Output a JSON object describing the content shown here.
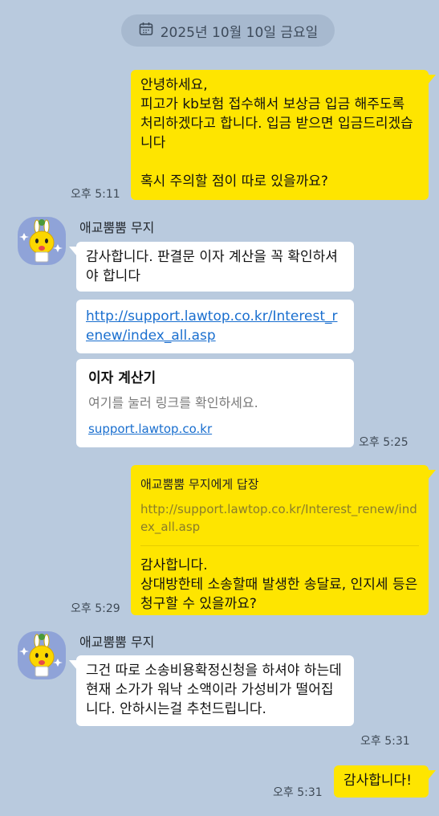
{
  "date_label": "2025년 10월 10일 금요일",
  "messages": {
    "m1": {
      "text": "안녕하세요,\n피고가 kb보험 접수해서 보상금 입금 해주도록 처리하겠다고 합니다. 입금 받으면 입금드리겠습니다\n\n혹시 주의할 점이 따로 있을까요?",
      "time": "오후 5:11"
    },
    "sender1": "애교뿜뿜 무지",
    "m2": {
      "text": "감사합니다. 판결문 이자 계산을 꼭 확인하셔야 합니다"
    },
    "m3": {
      "link": "http://support.lawtop.co.kr/Interest_renew/index_all.asp"
    },
    "m4": {
      "title": "이자 계산기",
      "desc": "여기를 눌러 링크를 확인하세요.",
      "domain": "support.lawtop.co.kr",
      "time": "오후 5:25"
    },
    "m5": {
      "reply_to": "애교뿜뿜 무지에게 답장",
      "quote": "http://support.lawtop.co.kr/Interest_renew/index_all.asp",
      "text": "감사합니다.\n상대방한테 소송할때 발생한 송달료, 인지세 등은 청구할 수 있을까요?",
      "time": "오후 5:29"
    },
    "sender2": "애교뿜뿜 무지",
    "m6": {
      "text": "그건 따로 소송비용확정신청을 하셔야 하는데\n현재 소가가 워낙 소액이라 가성비가 떨어집니다. 안하시는걸 추천드립니다.",
      "time": "오후 5:31"
    },
    "m7": {
      "text": "감사합니다!",
      "time": "오후 5:31"
    }
  },
  "colors": {
    "background": "#b9cade",
    "my_bubble": "#fee500",
    "their_bubble": "#ffffff",
    "link": "#1a6fcf"
  },
  "icons": {
    "date": "calendar-icon",
    "avatar": "muzi-character-avatar"
  }
}
